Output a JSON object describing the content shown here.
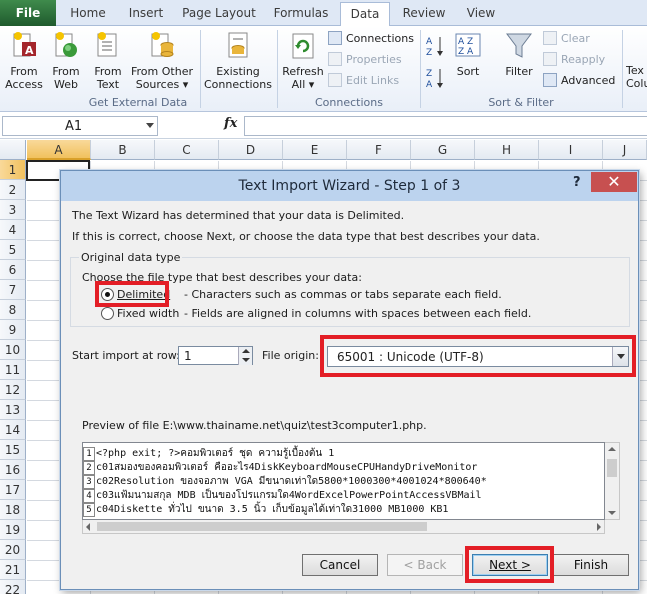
{
  "ribbon_tabs": [
    "File",
    "Home",
    "Insert",
    "Page Layout",
    "Formulas",
    "Data",
    "Review",
    "View"
  ],
  "ribbon": {
    "get_external": {
      "from_access": [
        "From",
        "Access"
      ],
      "from_web": [
        "From",
        "Web"
      ],
      "from_text": [
        "From",
        "Text"
      ],
      "from_other": [
        "From Other",
        "Sources"
      ],
      "existing": [
        "Existing",
        "Connections"
      ],
      "label": "Get External Data"
    },
    "connections": {
      "refresh": [
        "Refresh",
        "All"
      ],
      "connections": "Connections",
      "properties": "Properties",
      "edit_links": "Edit Links",
      "label": "Connections"
    },
    "sort_filter": {
      "sort": "Sort",
      "filter": "Filter",
      "clear": "Clear",
      "reapply": "Reapply",
      "advanced": "Advanced",
      "label": "Sort & Filter"
    },
    "partial": [
      "Tex",
      "Colu"
    ]
  },
  "formula_bar": {
    "name_box": "A1",
    "fx": "fx",
    "value": ""
  },
  "columns": [
    "A",
    "B",
    "C",
    "D",
    "E",
    "F",
    "G",
    "H",
    "I",
    "J"
  ],
  "rows": [
    "1",
    "2",
    "3",
    "4",
    "5",
    "6",
    "7",
    "8",
    "9",
    "10",
    "11",
    "12",
    "13",
    "14",
    "15",
    "16",
    "17",
    "18",
    "19",
    "20",
    "21",
    "22"
  ],
  "dialog": {
    "title": "Text Import Wizard - Step 1 of 3",
    "help": "?",
    "close": "✕",
    "intro1": "The Text Wizard has determined that your data is Delimited.",
    "intro2": "If this is correct, choose Next, or choose the data type that best describes your data.",
    "group_label": "Original data type",
    "group_hint": "Choose the file type that best describes your data:",
    "options": [
      {
        "label": "Delimited",
        "desc": "- Characters such as commas or tabs separate each field.",
        "selected": true
      },
      {
        "label": "Fixed width",
        "desc": "- Fields are aligned in columns with spaces between each field.",
        "selected": false
      }
    ],
    "start_row_label": "Start import at row:",
    "start_row_value": "1",
    "origin_label": "File origin:",
    "origin_value": "65001 : Unicode (UTF-8)",
    "preview_label": "Preview of file E:\\www.thainame.net\\quiz\\test3computer1.php.",
    "preview_lines": [
      {
        "n": "1",
        "text": "<?php exit; ?>คอมพิวเตอร์ ชุด ความรู้เบื้องต้น 1"
      },
      {
        "n": "2",
        "text": "c01สมองของคอมพิวเตอร์ คืออะไร4DiskKeyboardMouseCPUHandyDriveMonitor"
      },
      {
        "n": "3",
        "text": "c02Resolution ของจอภาพ VGA มีขนาดเท่าใด5800*1000300*4001024*800640*"
      },
      {
        "n": "4",
        "text": "c03แฟ้มนามสกุล MDB เป็นของโปรแกรมใด4WordExcelPowerPointAccessVBMail"
      },
      {
        "n": "5",
        "text": "c04Diskette ทั่วไป ขนาด 3.5 นิ้ว เก็บข้อมูลได้เท่าใด31000 MB1000 KB1"
      }
    ],
    "buttons": {
      "cancel": "Cancel",
      "back": "< Back",
      "next": "Next >",
      "finish": "Finish"
    }
  },
  "colors": {
    "highlight": "#e31e26",
    "title_bar": "#bcd3ee",
    "close": "#c75050"
  }
}
